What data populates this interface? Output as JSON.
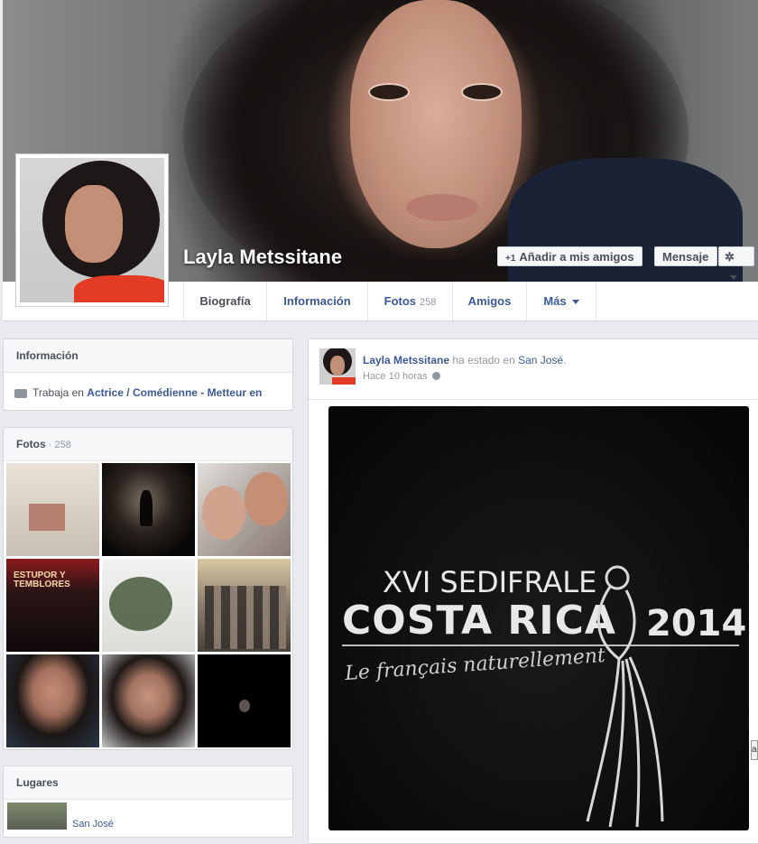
{
  "cover": {
    "name": "Layla Metssitane",
    "add_friend_label": "Añadir a mis amigos",
    "add_friend_prefix": "+1",
    "message_label": "Mensaje"
  },
  "tabs": [
    {
      "label": "Biografía",
      "active": true
    },
    {
      "label": "Información"
    },
    {
      "label": "Fotos",
      "count": "258"
    },
    {
      "label": "Amigos"
    },
    {
      "label": "Más"
    }
  ],
  "info_box": {
    "title": "Información",
    "line_prefix": "Trabaja en",
    "line_value": "Actrice / Comédienne - Metteur en"
  },
  "photos_box": {
    "title": "Fotos",
    "count": " · 258",
    "poster_text": "ESTUPOR Y TEMBLORES"
  },
  "places_box": {
    "title": "Lugares",
    "place": "San José"
  },
  "post": {
    "author": "Layla Metssitane",
    "action": " ha estado en ",
    "place": "San José",
    "suffix": ".",
    "time": "Hace 10 horas",
    "photo": {
      "line1": "XVI SEDIFRALE",
      "line2": "COSTA RICA",
      "year": "2014",
      "subtitle": "Le français naturellement"
    }
  },
  "colors": {
    "link": "#3b5998",
    "page_bg": "#e9eaed",
    "accent_red": "#e33b25"
  }
}
